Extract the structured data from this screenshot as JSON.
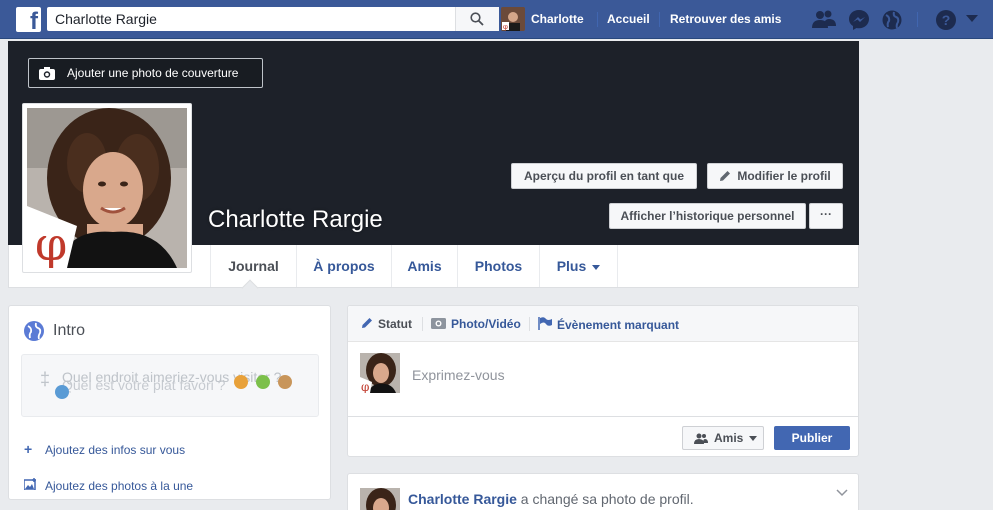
{
  "topbar": {
    "logo_letter": "f",
    "search_value": "Charlotte Rargie",
    "user_name": "Charlotte",
    "links": [
      "Accueil",
      "Retrouver des amis"
    ],
    "icons": [
      "friend-requests-icon",
      "messenger-icon",
      "notifications-globe-icon",
      "help-icon",
      "account-menu-chevron-icon"
    ],
    "bg_color": "#3b5998"
  },
  "cover": {
    "add_cover_label": "Ajouter une photo de couverture",
    "profile_name": "Charlotte Rargie",
    "preview_label": "Aperçu du profil en tant que",
    "edit_label": "Modifier le profil",
    "history_label": "Afficher l’historique personnel",
    "more_label": "···",
    "profile_badge_glyph": "φ",
    "bg_color": "#1d2129"
  },
  "tabs": {
    "items": [
      "Journal",
      "À propos",
      "Amis",
      "Photos",
      "Plus"
    ],
    "active": "Journal"
  },
  "intro": {
    "title": "Intro",
    "prompt_line1": "Quel endroit aimeriez-vous visiter ?",
    "prompt_line2": "Quel est votre plat favori ?",
    "link_add_info": "Ajoutez des infos sur vous",
    "link_add_photos": "Ajoutez des photos à la une"
  },
  "composer": {
    "tab_status": "Statut",
    "tab_photo": "Photo/Vidéo",
    "tab_event": "Évènement marquant",
    "placeholder": "Exprimez-vous",
    "audience_label": "Amis",
    "publish_label": "Publier",
    "accent_color": "#4267b2"
  },
  "story": {
    "actor": "Charlotte Rargie",
    "action": " a changé sa photo de profil."
  }
}
